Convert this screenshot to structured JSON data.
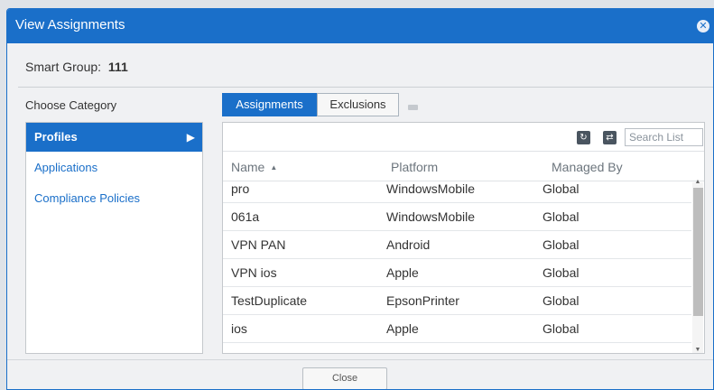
{
  "dialog": {
    "title": "View Assignments",
    "close_icon": "close-icon"
  },
  "smart_group": {
    "label": "Smart Group:",
    "value": "111"
  },
  "category": {
    "heading": "Choose Category",
    "items": [
      {
        "label": "Profiles",
        "active": true
      },
      {
        "label": "Applications",
        "active": false
      },
      {
        "label": "Compliance Policies",
        "active": false
      }
    ]
  },
  "tabs": [
    {
      "label": "Assignments",
      "active": true
    },
    {
      "label": "Exclusions",
      "active": false
    }
  ],
  "toolbar": {
    "refresh_icon": "refresh-icon",
    "export_icon": "export-icon",
    "search_placeholder": "Search List"
  },
  "table": {
    "columns": [
      "Name",
      "Platform",
      "Managed By"
    ],
    "sort_column": "Name",
    "rows": [
      [
        "pro",
        "WindowsMobile",
        "Global"
      ],
      [
        "061a",
        "WindowsMobile",
        "Global"
      ],
      [
        "VPN PAN",
        "Android",
        "Global"
      ],
      [
        "VPN ios",
        "Apple",
        "Global"
      ],
      [
        "TestDuplicate",
        "EpsonPrinter",
        "Global"
      ],
      [
        "ios",
        "Apple",
        "Global"
      ]
    ]
  },
  "footer": {
    "close_label": "Close"
  },
  "colors": {
    "accent": "#1a6fc9"
  }
}
